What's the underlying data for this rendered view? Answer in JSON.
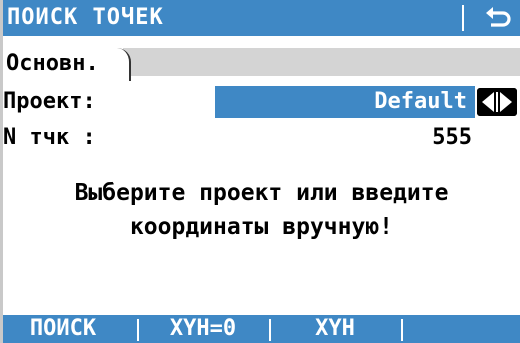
{
  "titlebar": {
    "title": "ПОИСК ТОЧЕК",
    "back_icon": "return-arrow-icon"
  },
  "tabs": [
    {
      "label": "Основн.",
      "active": true
    }
  ],
  "fields": {
    "project": {
      "label": "Проект:",
      "value": "Default"
    },
    "point_count": {
      "label": "N тчк :",
      "value": "555"
    }
  },
  "message": {
    "line1": "Выберите проект или введите",
    "line2": "координаты вручную!"
  },
  "softkeys": [
    "ПОИСК",
    "XYH=0",
    "XYH",
    ""
  ],
  "colors": {
    "accent": "#3f88c5",
    "background": "#ffffff",
    "strip": "#d4d4d4"
  }
}
